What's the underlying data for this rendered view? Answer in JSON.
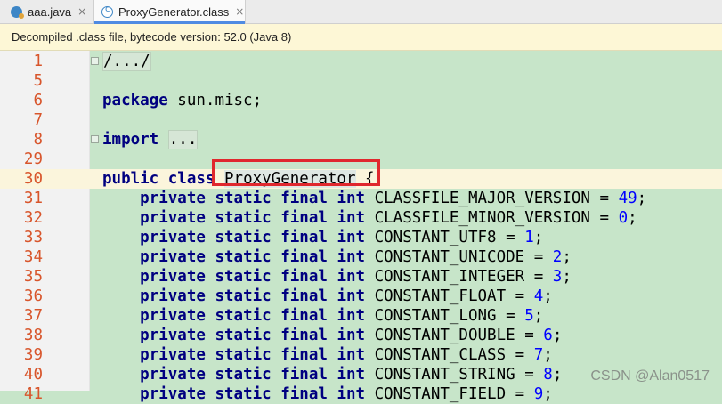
{
  "tabs": [
    {
      "label": "aaa.java",
      "close": "×"
    },
    {
      "label": "ProxyGenerator.class",
      "close": "×"
    }
  ],
  "banner": "Decompiled .class file, bytecode version: 52.0 (Java 8)",
  "lines": [
    {
      "num": "1",
      "text": "/.../"
    },
    {
      "num": "5",
      "text": ""
    },
    {
      "num": "6",
      "text": "package sun.misc;"
    },
    {
      "num": "7",
      "text": ""
    },
    {
      "num": "8",
      "text": "import ..."
    },
    {
      "num": "29",
      "text": ""
    },
    {
      "num": "30",
      "text": "public class ProxyGenerator {"
    },
    {
      "num": "31",
      "text": "    private static final int CLASSFILE_MAJOR_VERSION = 49;"
    },
    {
      "num": "32",
      "text": "    private static final int CLASSFILE_MINOR_VERSION = 0;"
    },
    {
      "num": "33",
      "text": "    private static final int CONSTANT_UTF8 = 1;"
    },
    {
      "num": "34",
      "text": "    private static final int CONSTANT_UNICODE = 2;"
    },
    {
      "num": "35",
      "text": "    private static final int CONSTANT_INTEGER = 3;"
    },
    {
      "num": "36",
      "text": "    private static final int CONSTANT_FLOAT = 4;"
    },
    {
      "num": "37",
      "text": "    private static final int CONSTANT_LONG = 5;"
    },
    {
      "num": "38",
      "text": "    private static final int CONSTANT_DOUBLE = 6;"
    },
    {
      "num": "39",
      "text": "    private static final int CONSTANT_CLASS = 7;"
    },
    {
      "num": "40",
      "text": "    private static final int CONSTANT_STRING = 8;"
    },
    {
      "num": "41",
      "text": "    private static final int CONSTANT_FIELD = 9;"
    }
  ],
  "watermark": "CSDN @Alan0517",
  "colors": {
    "editor_bg": "#c7e5c9",
    "line_number": "#d8552b",
    "keyword": "#000080",
    "number": "#0000ff",
    "highlight_box": "#e0282e"
  }
}
